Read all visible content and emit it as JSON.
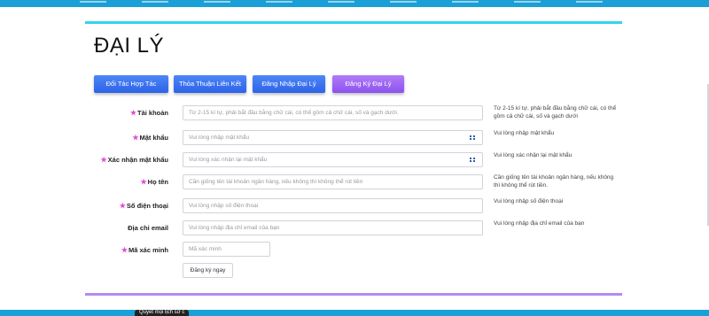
{
  "page": {
    "title": "ĐẠI LÝ"
  },
  "tabs": [
    {
      "label": "Đối Tác Hợp Tác"
    },
    {
      "label": "Thỏa Thuận Liên Kết"
    },
    {
      "label": "Đăng Nhập Đại Lý"
    },
    {
      "label": "Đăng Ký Đại Lý"
    }
  ],
  "form": {
    "required_mark": "★",
    "username": {
      "label": "Tài khoản",
      "placeholder": "Từ 2-15 kí tự, phải bắt đầu bằng chữ cái, có thể gồm cả chữ cái, số và gạch dưới.",
      "hint": "Từ 2-15 kí tự, phải bắt đầu bằng chữ cái, có thể gồm cả chữ cái, số và gạch dưới"
    },
    "password": {
      "label": "Mật khẩu",
      "placeholder": "Vui lòng nhập mật khẩu",
      "hint": "Vui lòng nhập mật khẩu"
    },
    "confirm_password": {
      "label": "Xác nhận mật khẩu",
      "placeholder": "Vui lòng xác nhận lại mật khẩu",
      "hint": "Vui lòng xác nhận lại mật khẩu"
    },
    "full_name": {
      "label": "Họ tên",
      "placeholder": "Cần giống tên tài khoản ngân hàng, nếu không thì không thể rút tiền",
      "hint": "Cần giống tên tài khoản ngân hàng, nếu không thì không thể rút tiền."
    },
    "phone": {
      "label": "Số điện thoại",
      "placeholder": "Vui lòng nhập số điện thoại",
      "hint": "Vui lòng nhập số điện thoại"
    },
    "email": {
      "label": "Địa chỉ email",
      "placeholder": "Vui lòng nhập địa chỉ email của bạn",
      "hint": "Vui lòng nhập địa chỉ email của bạn"
    },
    "captcha": {
      "label": "Mã xác minh",
      "placeholder": "Mã xác minh"
    },
    "submit_label": "Đăng ký ngay"
  },
  "footer": {
    "tooltip": "Quyết mọi lịch sử c"
  },
  "colors": {
    "accent_blue": "#2d63e8",
    "accent_purple": "#8c52ef",
    "top_rule": "#35d3ec",
    "bottom_rule": "#b38af5",
    "star": "#e04bd3"
  },
  "icons": {
    "keypad": "keypad-icon",
    "star": "required-star-icon"
  }
}
